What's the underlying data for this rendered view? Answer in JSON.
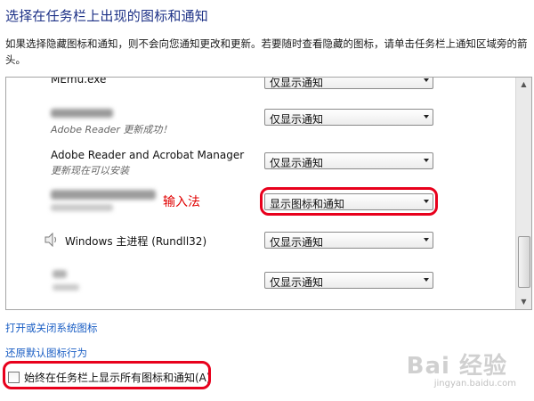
{
  "header": {
    "title": "选择在任务栏上出现的图标和通知",
    "description": "如果选择隐藏图标和通知，则不会向您通知更改和更新。若要随时查看隐藏的图标，请单击任务栏上通知区域旁的箭头。"
  },
  "rows": [
    {
      "name": "MEmu.exe",
      "sub": "",
      "behavior": "仅显示通知"
    },
    {
      "name": "",
      "sub": "Adobe Reader 更新成功！",
      "behavior": "仅显示通知"
    },
    {
      "name": "Adobe Reader and Acrobat Manager",
      "sub": "更新现在可以安装",
      "behavior": "仅显示通知"
    },
    {
      "name": "",
      "sub": "",
      "annotation": "输入法",
      "behavior": "显示图标和通知"
    },
    {
      "name": "Windows 主进程 (Rundll32)",
      "sub": "",
      "behavior": "仅显示通知"
    },
    {
      "name": "",
      "sub": "",
      "behavior": "仅显示通知"
    }
  ],
  "links": {
    "system_icons": "打开或关闭系统图标",
    "restore_defaults": "还原默认图标行为"
  },
  "always_show": {
    "label": "始终在任务栏上显示所有图标和通知(A)",
    "checked": false
  },
  "watermark": {
    "logo": "Bai 经验",
    "url": "jingyan.baidu.com"
  },
  "colors": {
    "title": "#1e3287",
    "link": "#1a5ec4",
    "highlight": "#e8001c",
    "annotation": "#e00000"
  }
}
